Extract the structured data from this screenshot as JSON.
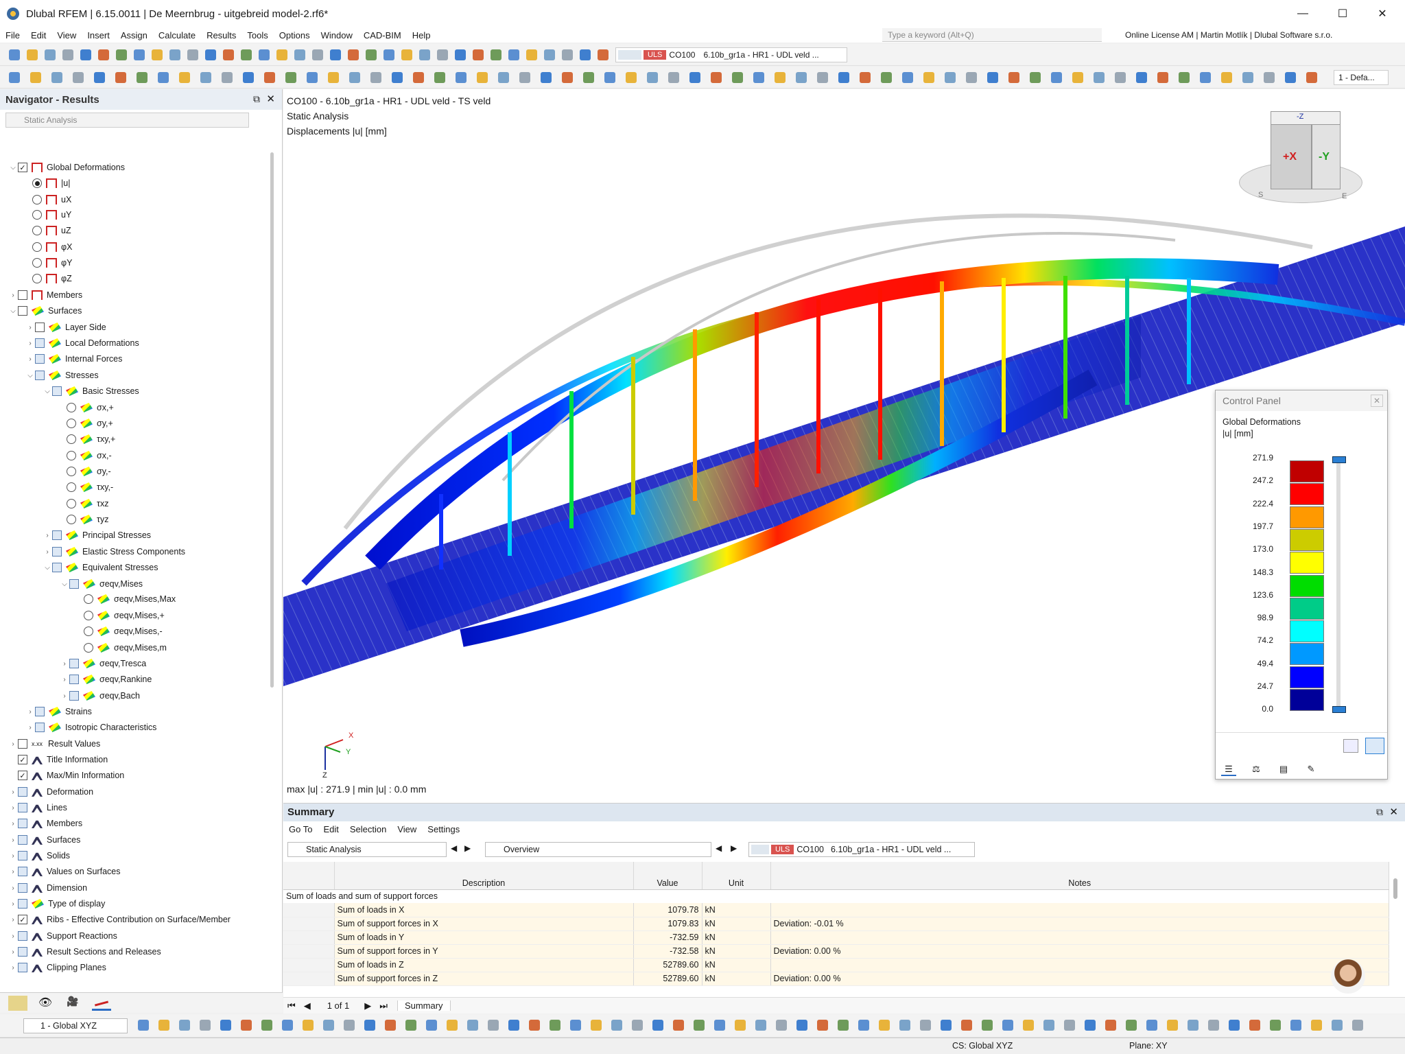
{
  "window": {
    "title": "Dlubal RFEM | 6.15.0011 | De Meernbrug - uitgebreid model-2.rf6*",
    "minimize": "—",
    "maximize": "☐",
    "close": "✕"
  },
  "menu": [
    "File",
    "Edit",
    "View",
    "Insert",
    "Assign",
    "Calculate",
    "Results",
    "Tools",
    "Options",
    "Window",
    "CAD-BIM",
    "Help"
  ],
  "search": {
    "placeholder": "Type a keyword (Alt+Q)"
  },
  "license": "Online License AM | Martin Motlík | Dlubal Software s.r.o.",
  "loadcase": {
    "type": "ULS",
    "code": "CO100",
    "name": "6.10b_gr1a - HR1 - UDL veld ..."
  },
  "navigator": {
    "title": "Navigator - Results",
    "analysis": "Static Analysis",
    "items": [
      {
        "label": "Global Deformations",
        "level": 0,
        "chev": "v",
        "cb": "check",
        "icon": "def"
      },
      {
        "label": "|u|",
        "level": 1,
        "radio": "on",
        "icon": "def"
      },
      {
        "label": "uX",
        "level": 1,
        "radio": "off",
        "icon": "def"
      },
      {
        "label": "uY",
        "level": 1,
        "radio": "off",
        "icon": "def"
      },
      {
        "label": "uZ",
        "level": 1,
        "radio": "off",
        "icon": "def"
      },
      {
        "label": "φX",
        "level": 1,
        "radio": "off",
        "icon": "def"
      },
      {
        "label": "φY",
        "level": 1,
        "radio": "off",
        "icon": "def"
      },
      {
        "label": "φZ",
        "level": 1,
        "radio": "off",
        "icon": "def"
      },
      {
        "label": "Members",
        "level": 0,
        "chev": ">",
        "cb": "empty",
        "icon": "def"
      },
      {
        "label": "Surfaces",
        "level": 0,
        "chev": "v",
        "cb": "empty",
        "icon": "grad"
      },
      {
        "label": "Layer Side",
        "level": 1,
        "chev": ">",
        "cb": "empty",
        "icon": "grad"
      },
      {
        "label": "Local Deformations",
        "level": 1,
        "chev": ">",
        "cb": "part",
        "icon": "grad"
      },
      {
        "label": "Internal Forces",
        "level": 1,
        "chev": ">",
        "cb": "part",
        "icon": "grad"
      },
      {
        "label": "Stresses",
        "level": 1,
        "chev": "v",
        "cb": "part",
        "icon": "grad"
      },
      {
        "label": "Basic Stresses",
        "level": 2,
        "chev": "v",
        "cb": "part",
        "icon": "grad"
      },
      {
        "label": "σx,+",
        "level": 3,
        "radio": "off",
        "icon": "grad"
      },
      {
        "label": "σy,+",
        "level": 3,
        "radio": "off",
        "icon": "grad"
      },
      {
        "label": "τxy,+",
        "level": 3,
        "radio": "off",
        "icon": "grad"
      },
      {
        "label": "σx,-",
        "level": 3,
        "radio": "off",
        "icon": "grad"
      },
      {
        "label": "σy,-",
        "level": 3,
        "radio": "off",
        "icon": "grad"
      },
      {
        "label": "τxy,-",
        "level": 3,
        "radio": "off",
        "icon": "grad"
      },
      {
        "label": "τxz",
        "level": 3,
        "radio": "off",
        "icon": "grad"
      },
      {
        "label": "τyz",
        "level": 3,
        "radio": "off",
        "icon": "grad"
      },
      {
        "label": "Principal Stresses",
        "level": 2,
        "chev": ">",
        "cb": "part",
        "icon": "grad"
      },
      {
        "label": "Elastic Stress Components",
        "level": 2,
        "chev": ">",
        "cb": "part",
        "icon": "grad"
      },
      {
        "label": "Equivalent Stresses",
        "level": 2,
        "chev": "v",
        "cb": "part",
        "icon": "grad"
      },
      {
        "label": "σeqv,Mises",
        "level": 3,
        "chev": "v",
        "cb": "part",
        "icon": "grad"
      },
      {
        "label": "σeqv,Mises,Max",
        "level": 4,
        "radio": "off",
        "icon": "grad"
      },
      {
        "label": "σeqv,Mises,+",
        "level": 4,
        "radio": "off",
        "icon": "grad"
      },
      {
        "label": "σeqv,Mises,-",
        "level": 4,
        "radio": "off",
        "icon": "grad"
      },
      {
        "label": "σeqv,Mises,m",
        "level": 4,
        "radio": "off",
        "icon": "grad"
      },
      {
        "label": "σeqv,Tresca",
        "level": 3,
        "chev": ">",
        "cb": "part",
        "icon": "grad"
      },
      {
        "label": "σeqv,Rankine",
        "level": 3,
        "chev": ">",
        "cb": "part",
        "icon": "grad"
      },
      {
        "label": "σeqv,Bach",
        "level": 3,
        "chev": ">",
        "cb": "part",
        "icon": "grad"
      },
      {
        "label": "Strains",
        "level": 1,
        "chev": ">",
        "cb": "part",
        "icon": "grad"
      },
      {
        "label": "Isotropic Characteristics",
        "level": 1,
        "chev": ">",
        "cb": "part",
        "icon": "grad"
      },
      {
        "label": "Result Values",
        "level": 0,
        "chev": ">",
        "cb": "empty",
        "icon": "xxx"
      },
      {
        "label": "Title Information",
        "level": 0,
        "chev": "",
        "cb": "check",
        "icon": "pin"
      },
      {
        "label": "Max/Min Information",
        "level": 0,
        "chev": "",
        "cb": "check",
        "icon": "pin"
      },
      {
        "label": "Deformation",
        "level": 0,
        "chev": ">",
        "cb": "part",
        "icon": "pin"
      },
      {
        "label": "Lines",
        "level": 0,
        "chev": ">",
        "cb": "part",
        "icon": "pin"
      },
      {
        "label": "Members",
        "level": 0,
        "chev": ">",
        "cb": "part",
        "icon": "pin"
      },
      {
        "label": "Surfaces",
        "level": 0,
        "chev": ">",
        "cb": "part",
        "icon": "pin"
      },
      {
        "label": "Solids",
        "level": 0,
        "chev": ">",
        "cb": "part",
        "icon": "pin"
      },
      {
        "label": "Values on Surfaces",
        "level": 0,
        "chev": ">",
        "cb": "part",
        "icon": "pin"
      },
      {
        "label": "Dimension",
        "level": 0,
        "chev": ">",
        "cb": "part",
        "icon": "pin"
      },
      {
        "label": "Type of display",
        "level": 0,
        "chev": ">",
        "cb": "part",
        "icon": "grad"
      },
      {
        "label": "Ribs - Effective Contribution on Surface/Member",
        "level": 0,
        "chev": ">",
        "cb": "check",
        "icon": "pin"
      },
      {
        "label": "Support Reactions",
        "level": 0,
        "chev": ">",
        "cb": "part",
        "icon": "pin"
      },
      {
        "label": "Result Sections and Releases",
        "level": 0,
        "chev": ">",
        "cb": "part",
        "icon": "pin"
      },
      {
        "label": "Clipping Planes",
        "level": 0,
        "chev": ">",
        "cb": "part",
        "icon": "pin"
      }
    ]
  },
  "viewport": {
    "line1": "CO100 - 6.10b_gr1a - HR1 - UDL veld - TS veld",
    "line2": "Static Analysis",
    "line3": "Displacements |u| [mm]",
    "maxmin": "max |u| : 271.9 | min |u| : 0.0 mm",
    "axes": {
      "x": "X",
      "y": "Y",
      "z": "Z"
    },
    "cube": {
      "x": "+X",
      "y": "-Y",
      "z": "-Z",
      "s": "S",
      "e": "E"
    }
  },
  "control_panel": {
    "title": "Control Panel",
    "subtitle1": "Global Deformations",
    "subtitle2": "|u| [mm]",
    "values": [
      "271.9",
      "247.2",
      "222.4",
      "197.7",
      "173.0",
      "148.3",
      "123.6",
      "98.9",
      "74.2",
      "49.4",
      "24.7",
      "0.0"
    ],
    "colors": [
      "#c00000",
      "#ff0000",
      "#ff9900",
      "#cccc00",
      "#ffff00",
      "#00dd00",
      "#00cc88",
      "#00ffff",
      "#0099ff",
      "#0000ff",
      "#000099"
    ]
  },
  "summary": {
    "title": "Summary",
    "menu": [
      "Go To",
      "Edit",
      "Selection",
      "View",
      "Settings"
    ],
    "analysis": "Static Analysis",
    "overview": "Overview",
    "columns": {
      "description": "Description",
      "value": "Value",
      "unit": "Unit",
      "notes": "Notes"
    },
    "group": "Sum of loads and sum of support forces",
    "rows": [
      {
        "d": "Sum of loads in X",
        "v": "1079.78",
        "u": "kN",
        "n": ""
      },
      {
        "d": "Sum of support forces in X",
        "v": "1079.83",
        "u": "kN",
        "n": "Deviation: -0.01 %"
      },
      {
        "d": "Sum of loads in Y",
        "v": "-732.59",
        "u": "kN",
        "n": ""
      },
      {
        "d": "Sum of support forces in Y",
        "v": "-732.58",
        "u": "kN",
        "n": "Deviation: 0.00 %"
      },
      {
        "d": "Sum of loads in Z",
        "v": "52789.60",
        "u": "kN",
        "n": ""
      },
      {
        "d": "Sum of support forces in Z",
        "v": "52789.60",
        "u": "kN",
        "n": "Deviation: 0.00 %"
      }
    ],
    "pager": "1 of 1",
    "tab": "Summary"
  },
  "bottom": {
    "cs_combo": "1 - Global XYZ",
    "status_cs": "CS: Global XYZ",
    "status_plane": "Plane: XY",
    "right_combo": "1 - Defa..."
  }
}
